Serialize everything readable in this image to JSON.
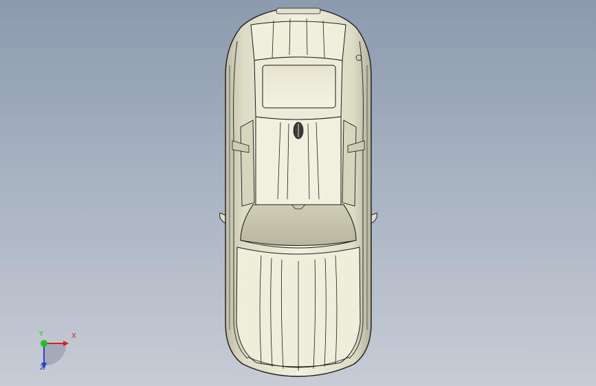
{
  "viewport": {
    "background_top": "#8c9aae",
    "background_bottom": "#c7ccd5"
  },
  "model": {
    "view": "top",
    "subject": "car",
    "body_color": "#e9e8d2",
    "edge_color": "#1a1a1a"
  },
  "triad": {
    "x_label": "X",
    "y_label": "Y",
    "z_label": "Z",
    "x_color": "#e11b1b",
    "y_color": "#1ec21e",
    "z_color": "#2a3fd8"
  }
}
